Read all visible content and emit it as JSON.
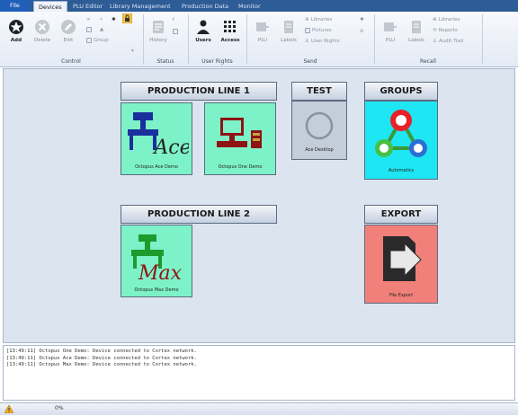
{
  "menu": {
    "tabs": [
      "File",
      "Devices",
      "PLU Editor",
      "Library Management",
      "Production Data",
      "Monitor"
    ],
    "active": "Devices"
  },
  "ribbon": {
    "control": {
      "label": "Control",
      "add": "Add",
      "delete": "Delete",
      "edit": "Edit",
      "group": "Group"
    },
    "status": {
      "label": "Status",
      "history": "History"
    },
    "user_rights": {
      "label": "User Rights",
      "users": "Users",
      "access": "Access"
    },
    "send": {
      "label": "Send",
      "plu": "PLU",
      "labels": "Labels",
      "libraries": "Libraries",
      "pictures": "Pictures",
      "user_rights": "User Rights"
    },
    "recall": {
      "label": "Recall",
      "plu": "PLU",
      "labels": "Labels",
      "libraries": "Libraries",
      "reports": "Reports",
      "audit_trail": "Audit Trail"
    }
  },
  "canvas": {
    "groups": [
      {
        "title": "PRODUCTION LINE 1",
        "devices": [
          "Octopus Ace Demo",
          "Octopus One Demo"
        ]
      },
      {
        "title": "TEST",
        "devices": [
          "Ace Desktop"
        ]
      },
      {
        "title": "GROUPS",
        "devices": [
          "Automatics"
        ]
      },
      {
        "title": "PRODUCTION LINE 2",
        "devices": [
          "Octopus Max Demo"
        ]
      },
      {
        "title": "EXPORT",
        "devices": [
          "File Export"
        ]
      }
    ],
    "art_text": {
      "ace": "Ace",
      "max": "Max"
    }
  },
  "log": [
    "[13:49:11] Octopus One Demo: Device connected to Cortex network.",
    "[13:49:11] Octopus Ace Demo: Device connected to Cortex network.",
    "[13:49:11] Octopus Max Demo: Device connected to Cortex network."
  ],
  "statusbar": {
    "progress_text": "0%"
  },
  "colors": {
    "mint": "#7df2c8",
    "grey": "#c4cdda",
    "cyan": "#1ee6f2",
    "salmon": "#f2807a",
    "tab_bar": "#2d5c97",
    "canvas": "#dbe4ef"
  }
}
